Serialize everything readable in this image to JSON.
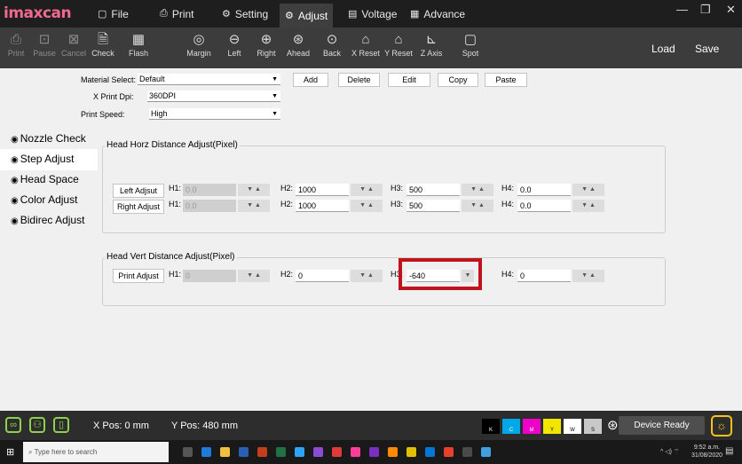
{
  "app": {
    "logo": "imaxcan"
  },
  "menu": {
    "items": [
      {
        "label": "File",
        "icon": "folder-icon"
      },
      {
        "label": "Print",
        "icon": "print-icon"
      },
      {
        "label": "Setting",
        "icon": "gear-icon"
      },
      {
        "label": "Adjust",
        "icon": "gear-icon",
        "active": true
      },
      {
        "label": "Voltage",
        "icon": "document-icon"
      },
      {
        "label": "Advance",
        "icon": "grid-icon"
      }
    ]
  },
  "window_controls": [
    "minimize-icon",
    "restore-icon",
    "close-icon"
  ],
  "toolbar": {
    "items": [
      {
        "label": "Print",
        "icon": "print-icon"
      },
      {
        "label": "Pause",
        "icon": "pause-icon"
      },
      {
        "label": "Cancel",
        "icon": "cancel-icon"
      },
      {
        "label": "Check",
        "icon": "check-icon"
      },
      {
        "label": "Flash",
        "icon": "flash-icon"
      },
      {
        "label": "Margin",
        "icon": "margin-icon"
      },
      {
        "label": "Left",
        "icon": "arrow-left-icon"
      },
      {
        "label": "Right",
        "icon": "arrow-right-icon"
      },
      {
        "label": "Ahead",
        "icon": "arrow-up-icon"
      },
      {
        "label": "Back",
        "icon": "arrow-down-icon"
      },
      {
        "label": "X Reset",
        "icon": "home-icon"
      },
      {
        "label": "Y Reset",
        "icon": "home-icon"
      },
      {
        "label": "Z Axis",
        "icon": "z-axis-icon"
      },
      {
        "label": "Spot",
        "icon": "spot-icon"
      }
    ],
    "load": "Load",
    "save": "Save"
  },
  "form": {
    "material_label": "Material Select:",
    "material_value": "Default",
    "dpi_label": "X Print Dpi:",
    "dpi_value": "360DPI",
    "speed_label": "Print Speed:",
    "speed_value": "High",
    "add": "Add",
    "delete": "Delete",
    "edit": "Edit",
    "copy": "Copy",
    "paste": "Paste"
  },
  "sidebar": {
    "items": [
      "Nozzle Check",
      "Step Adjust",
      "Head Space",
      "Color Adjust",
      "Bidirec Adjust"
    ],
    "selected": "Step Adjust"
  },
  "horz": {
    "title": "Head Horz Distance Adjust(Pixel)",
    "rows": [
      {
        "button": "Left Adjsut",
        "h1": "0.0",
        "h2": "1000",
        "h3": "500",
        "h4": "0.0"
      },
      {
        "button": "Right Adjust",
        "h1": "0.0",
        "h2": "1000",
        "h3": "500",
        "h4": "0.0"
      }
    ]
  },
  "vert": {
    "title": "Head Vert Distance Adjust(Pixel)",
    "button": "Print Adjust",
    "h1": "0",
    "h2": "0",
    "h3": "-640",
    "h4": "0"
  },
  "labels": {
    "h1": "H1:",
    "h2": "H2:",
    "h3": "H3:",
    "h4": "H4:"
  },
  "status": {
    "xpos": "X Pos: 0 mm",
    "ypos": "Y Pos: 480 mm",
    "device": "Device Ready",
    "inks": [
      {
        "label": "K",
        "color": "#000000"
      },
      {
        "label": "C",
        "color": "#00a8e8"
      },
      {
        "label": "M",
        "color": "#ee00c8"
      },
      {
        "label": "Y",
        "color": "#f2e600"
      },
      {
        "label": "W",
        "color": "#ffffff"
      },
      {
        "label": "S",
        "color": "#c8c8c8"
      }
    ]
  },
  "taskbar": {
    "search_placeholder": "Type here to search",
    "time": "9:52 a.m.",
    "date": "31/08/2020"
  }
}
